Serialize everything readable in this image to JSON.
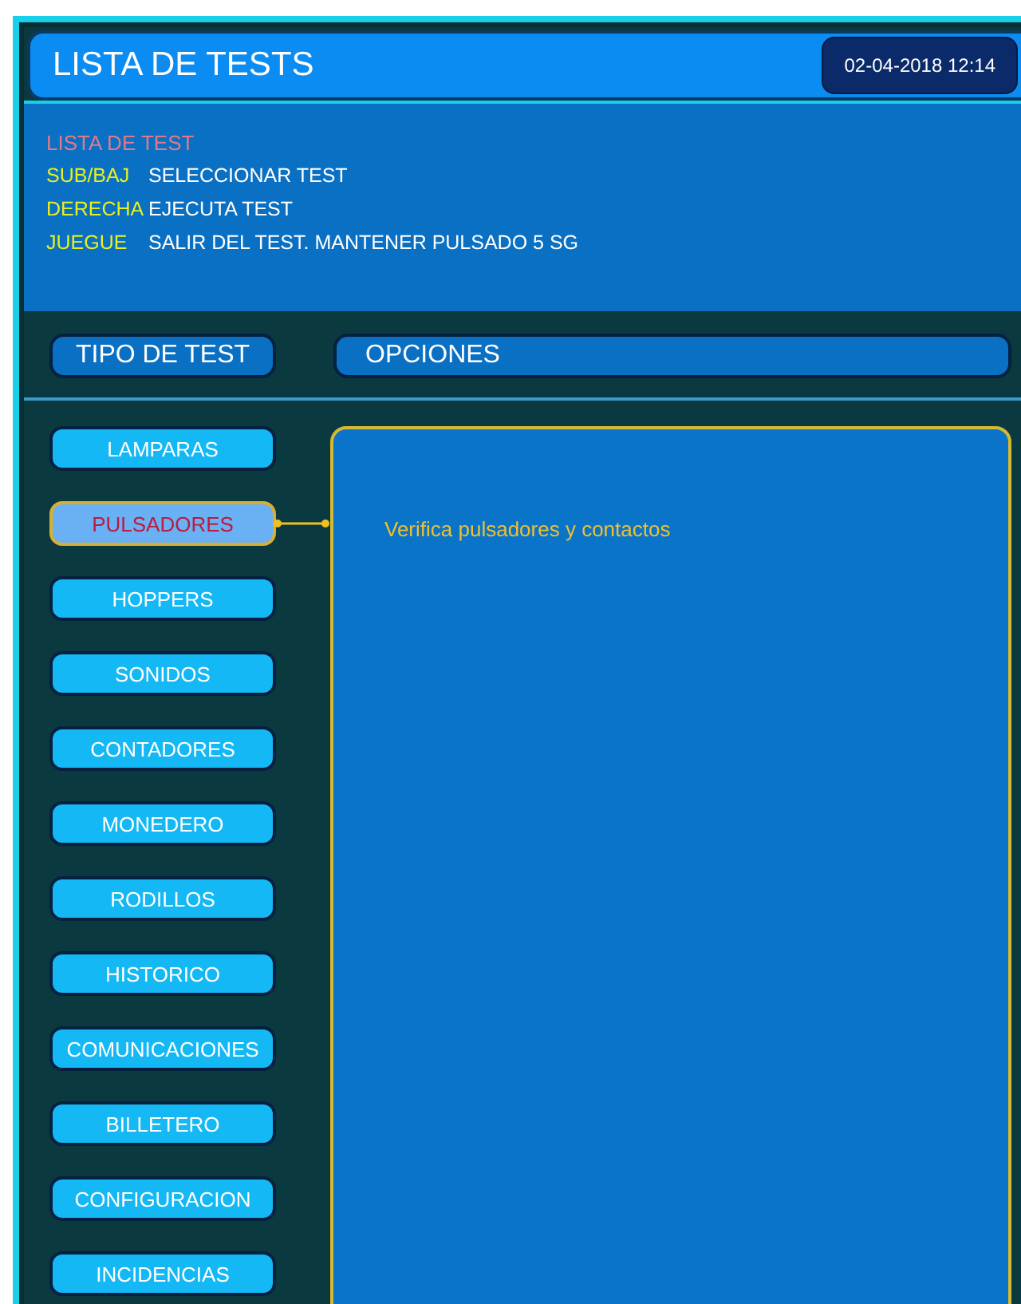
{
  "header": {
    "title": "LISTA DE TESTS",
    "datetime": "02-04-2018 12:14"
  },
  "help": {
    "heading": "LISTA DE TEST",
    "lines": [
      {
        "key": "SUB/BAJ",
        "action": "SELECCIONAR TEST"
      },
      {
        "key": "DERECHA",
        "action": "EJECUTA TEST"
      },
      {
        "key": "JUEGUE",
        "action": "SALIR DEL TEST. MANTENER PULSADO 5 SG"
      }
    ]
  },
  "section_headings": {
    "tests": "TIPO DE TEST",
    "options": "OPCIONES"
  },
  "tests": [
    {
      "label": "LAMPARAS",
      "selected": false
    },
    {
      "label": "PULSADORES",
      "selected": true
    },
    {
      "label": "HOPPERS",
      "selected": false
    },
    {
      "label": "SONIDOS",
      "selected": false
    },
    {
      "label": "CONTADORES",
      "selected": false
    },
    {
      "label": "MONEDERO",
      "selected": false
    },
    {
      "label": "RODILLOS",
      "selected": false
    },
    {
      "label": "HISTORICO",
      "selected": false
    },
    {
      "label": "COMUNICACIONES",
      "selected": false
    },
    {
      "label": "BILLETERO",
      "selected": false
    },
    {
      "label": "CONFIGURACION",
      "selected": false
    },
    {
      "label": "INCIDENCIAS",
      "selected": false
    }
  ],
  "options_panel": {
    "description": "Verifica pulsadores y contactos"
  }
}
